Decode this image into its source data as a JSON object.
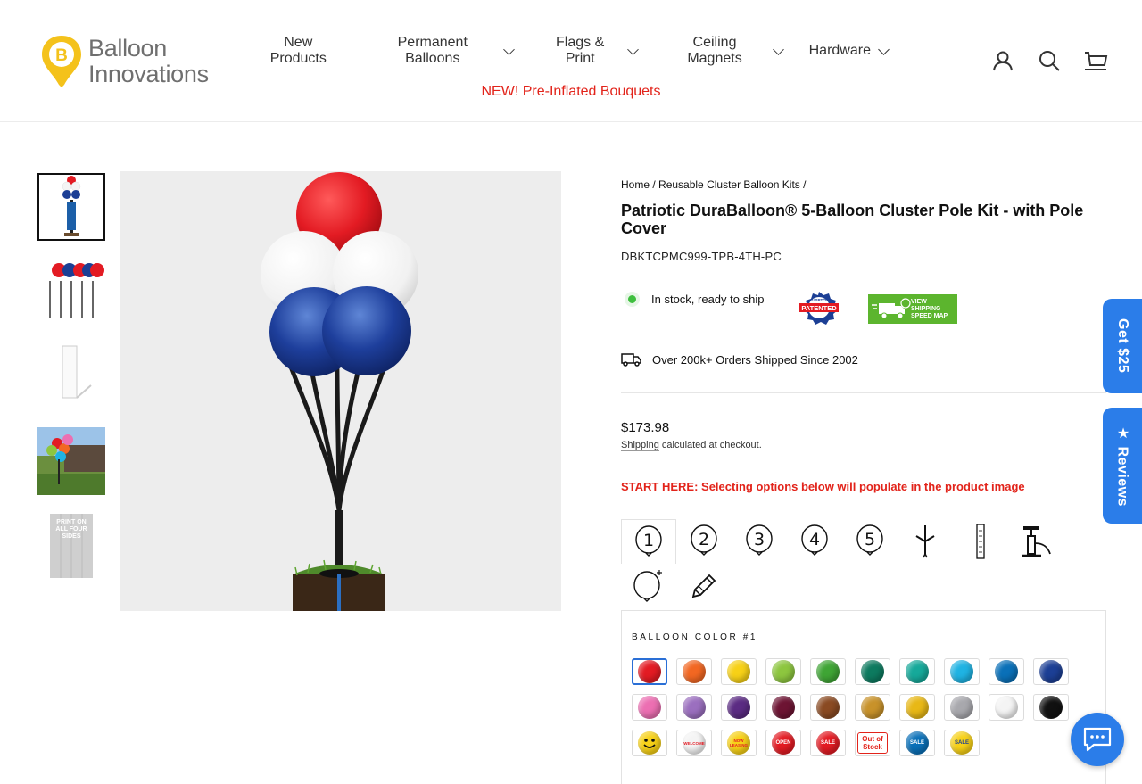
{
  "brand": {
    "name_line1": "Balloon",
    "name_line2": "Innovations",
    "accent": "#f4c21b"
  },
  "nav": {
    "items": [
      {
        "label": "New Products",
        "dropdown": false
      },
      {
        "label": "Permanent Balloons",
        "dropdown": true
      },
      {
        "label": "Flags & Print",
        "dropdown": true
      },
      {
        "label": "Ceiling Magnets",
        "dropdown": true
      },
      {
        "label": "Hardware",
        "dropdown": true
      }
    ],
    "highlight": "NEW! Pre-Inflated Bouquets",
    "highlight_color": "#e2231a"
  },
  "header_icons": [
    "account-icon",
    "search-icon",
    "cart-icon"
  ],
  "gallery": {
    "thumbnails": [
      "pole-kit-thumb",
      "cluster-lineup-thumb",
      "pole-cover-thumb",
      "storefront-photo-thumb",
      "print-on-all-four-sides-thumb"
    ],
    "print_note": "PRINT ON ALL FOUR SIDES",
    "active_index": 0
  },
  "product": {
    "breadcrumb": [
      "Home",
      "Reusable Cluster Balloon Kits"
    ],
    "title": "Patriotic DuraBalloon® 5-Balloon Cluster Pole Kit - with Pole Cover",
    "sku": "DBKTCPMC999-TPB-4TH-PC",
    "stock": "In stock, ready to ship",
    "patent_badge": "PATENTED",
    "patent_sub": "USPTO",
    "ship_map_label": "VIEW SHIPPING SPEED MAP",
    "orders": "Over 200k+ Orders Shipped Since 2002",
    "price": "$173.98",
    "shipping_link": "Shipping",
    "shipping_rest": " calculated at checkout.",
    "start_here": "START HERE: Selecting options below will populate in the product image"
  },
  "option_tabs": [
    "1",
    "2",
    "3",
    "4",
    "5",
    "stake-icon",
    "pole-cover-icon",
    "pump-icon",
    "add-balloon-icon",
    "edit-icon"
  ],
  "balloon_color": {
    "label": "BALLOON COLOR #1",
    "rows": [
      [
        "#e31b23",
        "#f26722",
        "#f7d117",
        "#8dc63f",
        "#3fa535",
        "#0d7a5f",
        "#16a99a",
        "#1fb3e3",
        "#0a70b8",
        "#1c3f95"
      ],
      [
        "#ec6fb2",
        "#9b6fbf",
        "#5b2b83",
        "#6d1433",
        "#8a4a22",
        "#c8922a",
        "#e8b816",
        "#a8a8ad",
        "#f4f4f4",
        "#111111"
      ],
      [
        "smiley",
        "WELCOME",
        "NOW LEASING",
        "OPEN",
        "SALE",
        "Out of Stock",
        "SALE",
        "SALE"
      ]
    ],
    "out_of_stock_text": "Out of Stock"
  },
  "side_tabs": {
    "get": "Get $25",
    "reviews": "Reviews"
  }
}
